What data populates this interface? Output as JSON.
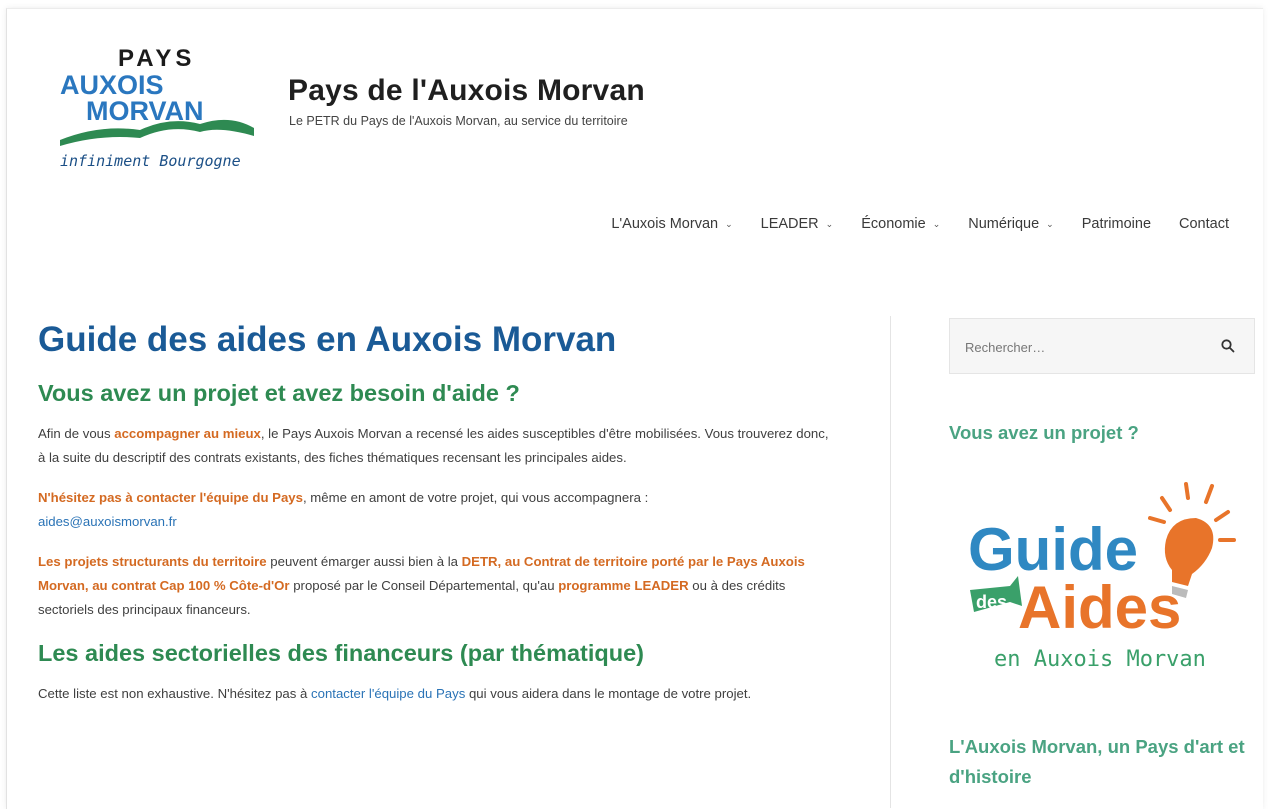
{
  "header": {
    "logo": {
      "line1": "PAYS",
      "line2": "AUXOIS",
      "line3": "MORVAN",
      "line4": "infiniment Bourgogne"
    },
    "site_title": "Pays de l'Auxois Morvan",
    "tagline": "Le PETR du Pays de l'Auxois Morvan, au service du territoire"
  },
  "nav": {
    "items": [
      {
        "label": "L'Auxois Morvan",
        "has_dropdown": true
      },
      {
        "label": "LEADER",
        "has_dropdown": true
      },
      {
        "label": "Économie",
        "has_dropdown": true
      },
      {
        "label": "Numérique",
        "has_dropdown": true
      },
      {
        "label": "Patrimoine",
        "has_dropdown": false
      },
      {
        "label": "Contact",
        "has_dropdown": false
      }
    ]
  },
  "main": {
    "title": "Guide des aides en Auxois Morvan",
    "section1_heading": "Vous avez un projet et avez besoin d'aide ?",
    "p1": {
      "a": "Afin de vous ",
      "b": "accompagner au mieux",
      "c": ", le Pays Auxois Morvan a recensé les aides susceptibles d'être mobilisées. Vous trouverez donc, à la suite du descriptif des contrats existants, des fiches thématiques recensant les principales aides."
    },
    "p2": {
      "a": "N'hésitez pas à contacter l'équipe du Pays",
      "b": ", même en amont de votre projet, qui vous accompagnera :",
      "email": "aides@auxoismorvan.fr"
    },
    "p3": {
      "a": "Les projets structurants du territoire",
      "b": " peuvent émarger aussi bien à la ",
      "c": "DETR, au Contrat de territoire porté par le Pays Auxois Morvan, au contrat Cap 100 % Côte-d'Or",
      "d": " proposé par le Conseil Départemental, qu'au ",
      "e": "programme LEADER",
      "f": " ou à des crédits sectoriels des principaux financeurs."
    },
    "section2_heading": "Les aides sectorielles des financeurs (par thématique)",
    "p4": {
      "a": "Cette liste est non exhaustive. N'hésitez pas à ",
      "link": "contacter l'équipe du Pays",
      "b": " qui vous aidera dans le montage de votre projet."
    }
  },
  "sidebar": {
    "search_placeholder": "Rechercher…",
    "widget1_title": "Vous avez un projet ?",
    "guide": {
      "word1": "Guide",
      "word2": "des",
      "word3": "Aides",
      "word4": "en Auxois Morvan"
    },
    "widget2_title": "L'Auxois Morvan, un Pays d'art et d'histoire"
  },
  "colors": {
    "title_blue": "#1a5a96",
    "heading_green": "#2e8a52",
    "accent_orange": "#d46a22",
    "link_blue": "#2a73b6",
    "sidebar_green": "#4aa382"
  }
}
